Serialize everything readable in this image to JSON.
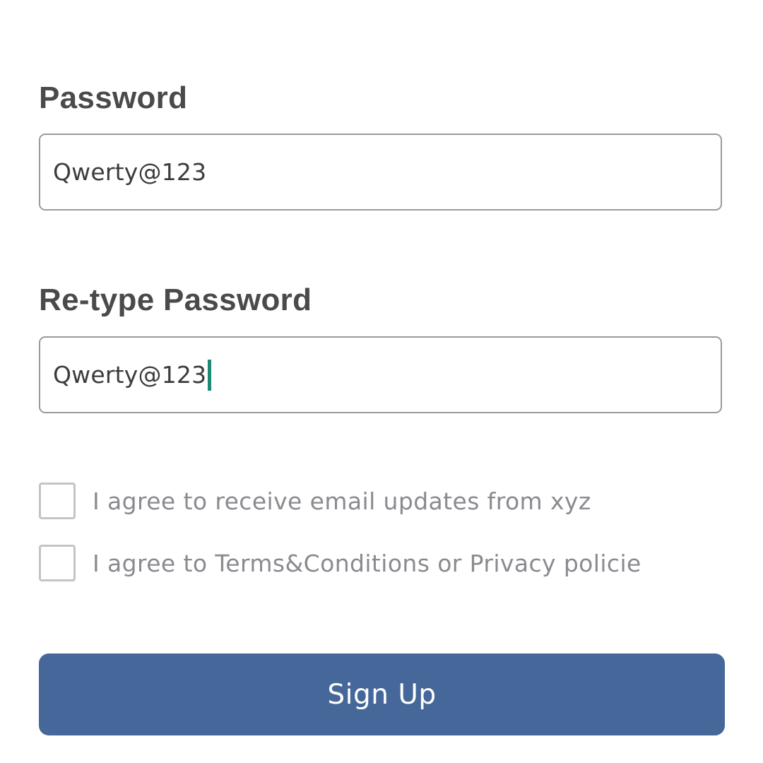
{
  "form": {
    "password": {
      "label": "Password",
      "value": "Qwerty@123"
    },
    "retype_password": {
      "label": "Re-type Password",
      "value": "Qwerty@123"
    },
    "checkboxes": [
      {
        "label": "I agree to receive email updates from xyz",
        "checked": false
      },
      {
        "label": "I agree to Terms&Conditions or Privacy policie",
        "checked": false
      }
    ],
    "submit_label": "Sign Up"
  },
  "colors": {
    "accent_button": "#456799",
    "caret": "#1f8a73",
    "label_text": "#4a4a4a",
    "muted_text": "#8a8a90"
  }
}
